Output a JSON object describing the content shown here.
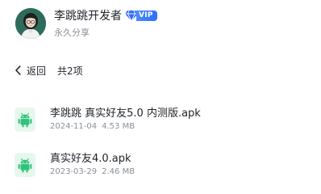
{
  "owner": {
    "name": "李跳跳开发者",
    "badge": "VIP",
    "share_type": "永久分享"
  },
  "nav": {
    "back_label": "返回",
    "count_label": "共2项"
  },
  "files": [
    {
      "name": "李跳跳  真实好友5.0  内测版.apk",
      "date": "2024-11-04",
      "size": "4.53 MB",
      "icon": "android-icon"
    },
    {
      "name": "真实好友4.0.apk",
      "date": "2023-03-29",
      "size": "2.46 MB",
      "icon": "android-icon"
    }
  ],
  "colors": {
    "accent": "#2f6df6",
    "android_green": "#2fc37a",
    "file_icon_bg": "#e6f8ee",
    "muted_text": "#8a9099"
  }
}
